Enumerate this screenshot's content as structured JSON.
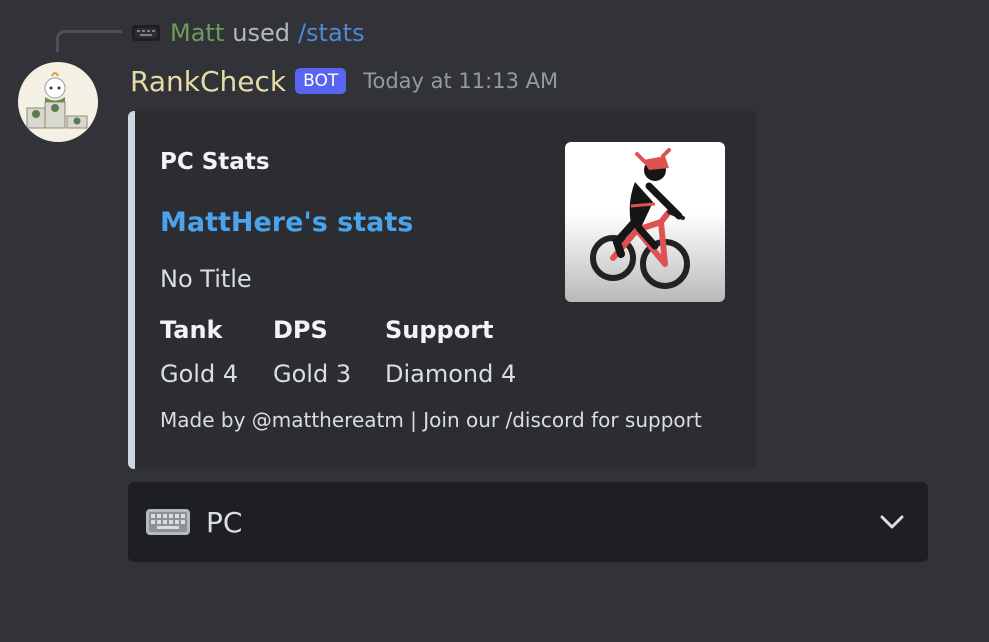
{
  "reply": {
    "icon": "keyboard-icon",
    "user": "Matt",
    "used_text": "used",
    "command": "/stats"
  },
  "message": {
    "username": "RankCheck",
    "bot_tag": "BOT",
    "timestamp": "Today at 11:13 AM",
    "avatar_icon": "podium-avatar-icon"
  },
  "embed": {
    "accent_color": "#cdd7df",
    "author": "PC Stats",
    "title": "MattHere's stats",
    "description": "No Title",
    "fields": [
      {
        "name": "Tank",
        "value": "Gold 4"
      },
      {
        "name": "DPS",
        "value": "Gold 3"
      },
      {
        "name": "Support",
        "value": "Diamond 4"
      }
    ],
    "footer": "Made by @matthereatm | Join our /discord for support",
    "thumbnail_icon": "cyclist-icon"
  },
  "select_menu": {
    "icon": "keyboard-icon",
    "label": "PC",
    "chevron_icon": "chevron-down-icon"
  },
  "colors": {
    "background": "#313338",
    "embed_bg": "#2b2d31",
    "link": "#4aa4ec",
    "bot_tag": "#5865f2",
    "username": "#e6dca8",
    "reply_user": "#6e9a5d",
    "reply_command": "#4e8ad1"
  }
}
